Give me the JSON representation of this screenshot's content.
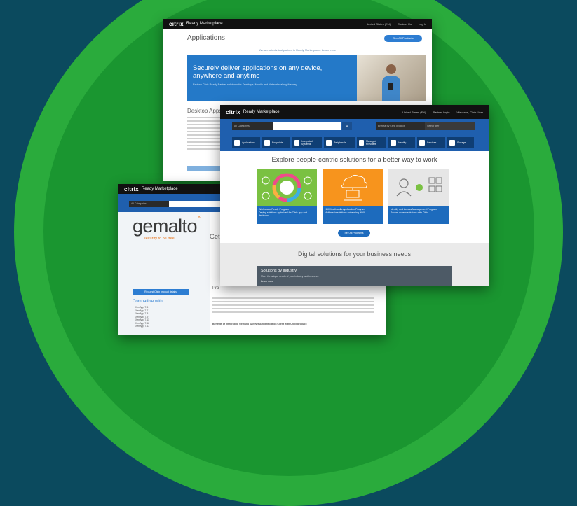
{
  "colors": {
    "background": "#0b4a5e",
    "ring_outer": "#2aab3c",
    "ring_inner": "#1a9630",
    "citrix_blue": "#1f5fae",
    "accent_orange": "#f7941d",
    "accent_green": "#7ac142"
  },
  "back_screen": {
    "logo": "citrix",
    "brand": "Ready Marketplace",
    "top_links": [
      "United States (EN)",
      "Contact Us",
      "Log In"
    ],
    "page_title": "Applications",
    "see_all_button": "See All Products",
    "note": "We are a technical partner to Ready Marketplace. Learn more",
    "hero_title": "Securely deliver applications on any device, anywhere and anytime",
    "hero_subtitle": "Explore Citrix Ready Partner solutions for Desktops, Mobile and Networks along the way",
    "section_title": "Desktop Apps"
  },
  "left_screen": {
    "logo": "citrix",
    "brand": "Ready Marketplace",
    "category_select": "All Categories",
    "partner_logo": "gemalto",
    "partner_tagline": "security to be free",
    "cut_title": "Get",
    "cut_title_2": "Pro",
    "request_button": "Request Citrix product details",
    "compatible_title": "Compatible with:",
    "compatible_list": [
      "XenApp 7.6",
      "XenApp 7.7",
      "XenApp 7.8",
      "XenApp 7.9",
      "XenApp 7.11",
      "XenApp 7.12",
      "XenApp 7.13"
    ],
    "benefit_heading": "Benefits of integrating Gemalto SafeNet Authentication Client with Citrix product:"
  },
  "front_screen": {
    "logo": "citrix",
    "brand": "Ready Marketplace",
    "top_links": [
      "United States (EN)",
      "Partner Login",
      "Welcome, Citrix User"
    ],
    "category_select": "All Categories",
    "search_icon": "search-icon",
    "filter_1": "Browse by Citrix product",
    "filter_2": "Select filter",
    "nav_tabs": [
      {
        "label": "Applications",
        "icon": "apps-icon"
      },
      {
        "label": "Endpoints",
        "icon": "endpoint-icon"
      },
      {
        "label": "Integrated Systems",
        "icon": "wrench-icon"
      },
      {
        "label": "Peripherals",
        "icon": "peripheral-icon"
      },
      {
        "label": "Managed Providers",
        "icon": "cloud-icon"
      },
      {
        "label": "Identity",
        "icon": "identity-icon"
      },
      {
        "label": "Services",
        "icon": "gear-icon"
      },
      {
        "label": "Storage",
        "icon": "storage-icon"
      }
    ],
    "explore_heading": "Explore people-centric solutions for a better way to work",
    "cards": [
      {
        "title": "Workspace Ready Program",
        "desc": "Deploy solutions optimized for Citrix app and desktops"
      },
      {
        "title": "HDX Multimedia Application Program",
        "desc": "Multimedia solutions enhancing HDX"
      },
      {
        "title": "Identity and Access Management Program",
        "desc": "Secure access solutions with Citrix"
      }
    ],
    "see_all_button": "See All Programs",
    "digital_heading": "Digital solutions for your business needs",
    "industry_title": "Solutions by Industry",
    "industry_subtitle": "Meet the unique needs of your industry and business.",
    "industry_link": "Learn more"
  }
}
